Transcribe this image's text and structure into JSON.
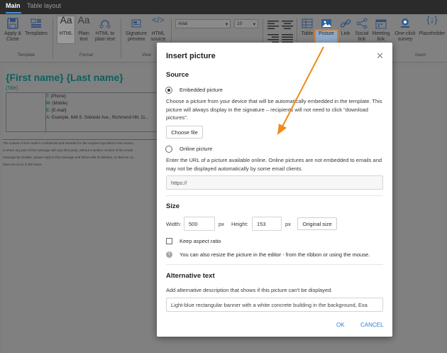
{
  "tabs": [
    "Main",
    "Table layout"
  ],
  "ribbon": {
    "buttons": [
      {
        "label": "Apply &\nClose"
      },
      {
        "label": "Templates"
      },
      {
        "label": "HTML"
      },
      {
        "label": "Plain\ntext"
      },
      {
        "label": "HTML to\nplain text"
      },
      {
        "label": "Signature\npreview"
      },
      {
        "label": "HTML\nsource"
      },
      {
        "label": "Table"
      },
      {
        "label": "Picture"
      },
      {
        "label": "Link"
      },
      {
        "label": "Social\nlink"
      },
      {
        "label": "Meeting\nlink"
      },
      {
        "label": "One-click\nsurvey"
      },
      {
        "label": "Placeholder"
      }
    ],
    "groups": [
      "Template",
      "Format",
      "View",
      "Insert"
    ],
    "font": "Arial",
    "size": "10"
  },
  "editor": {
    "name": "{First name} {Last name}",
    "title": "{Title}",
    "rows": [
      {
        "key": "T:",
        "value": "{Phone}"
      },
      {
        "key": "M:",
        "value": "{Mobile}"
      },
      {
        "key": "E:",
        "value": "{E-mail}"
      },
      {
        "key": "A:",
        "value": "Example, 648 S. Sobieski Ave., Richmond Hill, 11..."
      }
    ],
    "disclaimer": [
      "The content of this email is confidential and intended for the recipient specified in the messa...",
      "to share any part of this message with any third party, without a written consent of the sende...",
      "message by mistake, please reply to this message and follow with its deletion, so that we ca...",
      "does not occur in the future."
    ]
  },
  "dialog": {
    "title": "Insert picture",
    "source_heading": "Source",
    "embedded_label": "Embedded picture",
    "embedded_desc": "Choose a picture from your device that will be automatically embedded in the template. This picture will always display in the signature – recipients will not need to click \"download pictures\".",
    "choose_file": "Choose file",
    "online_label": "Online picture",
    "online_desc": "Enter the URL of a picture available online. Online pictures are not embedded to emails and may not be displayed automatically by some email clients.",
    "url_placeholder": "https://",
    "size_heading": "Size",
    "width_label": "Width:",
    "width_value": "500",
    "px1": "px",
    "height_label": "Height:",
    "height_value": "153",
    "px2": "px",
    "original_size": "Original size",
    "keep_ratio": "Keep aspect ratio",
    "resize_hint": "You can also resize the picture in the editor - from the ribbon or using the mouse.",
    "alt_heading": "Alternative text",
    "alt_desc": "Add alternative description that shows if this picture can't be displayed.",
    "alt_value": "Light-blue rectangular banner with a white concrete building in the background, Exa",
    "ok": "OK",
    "cancel": "CANCEL"
  },
  "colors": {
    "accent": "#2b7fd4",
    "highlight": "#e07a1f",
    "signature_teal": "#0f5f5c"
  }
}
